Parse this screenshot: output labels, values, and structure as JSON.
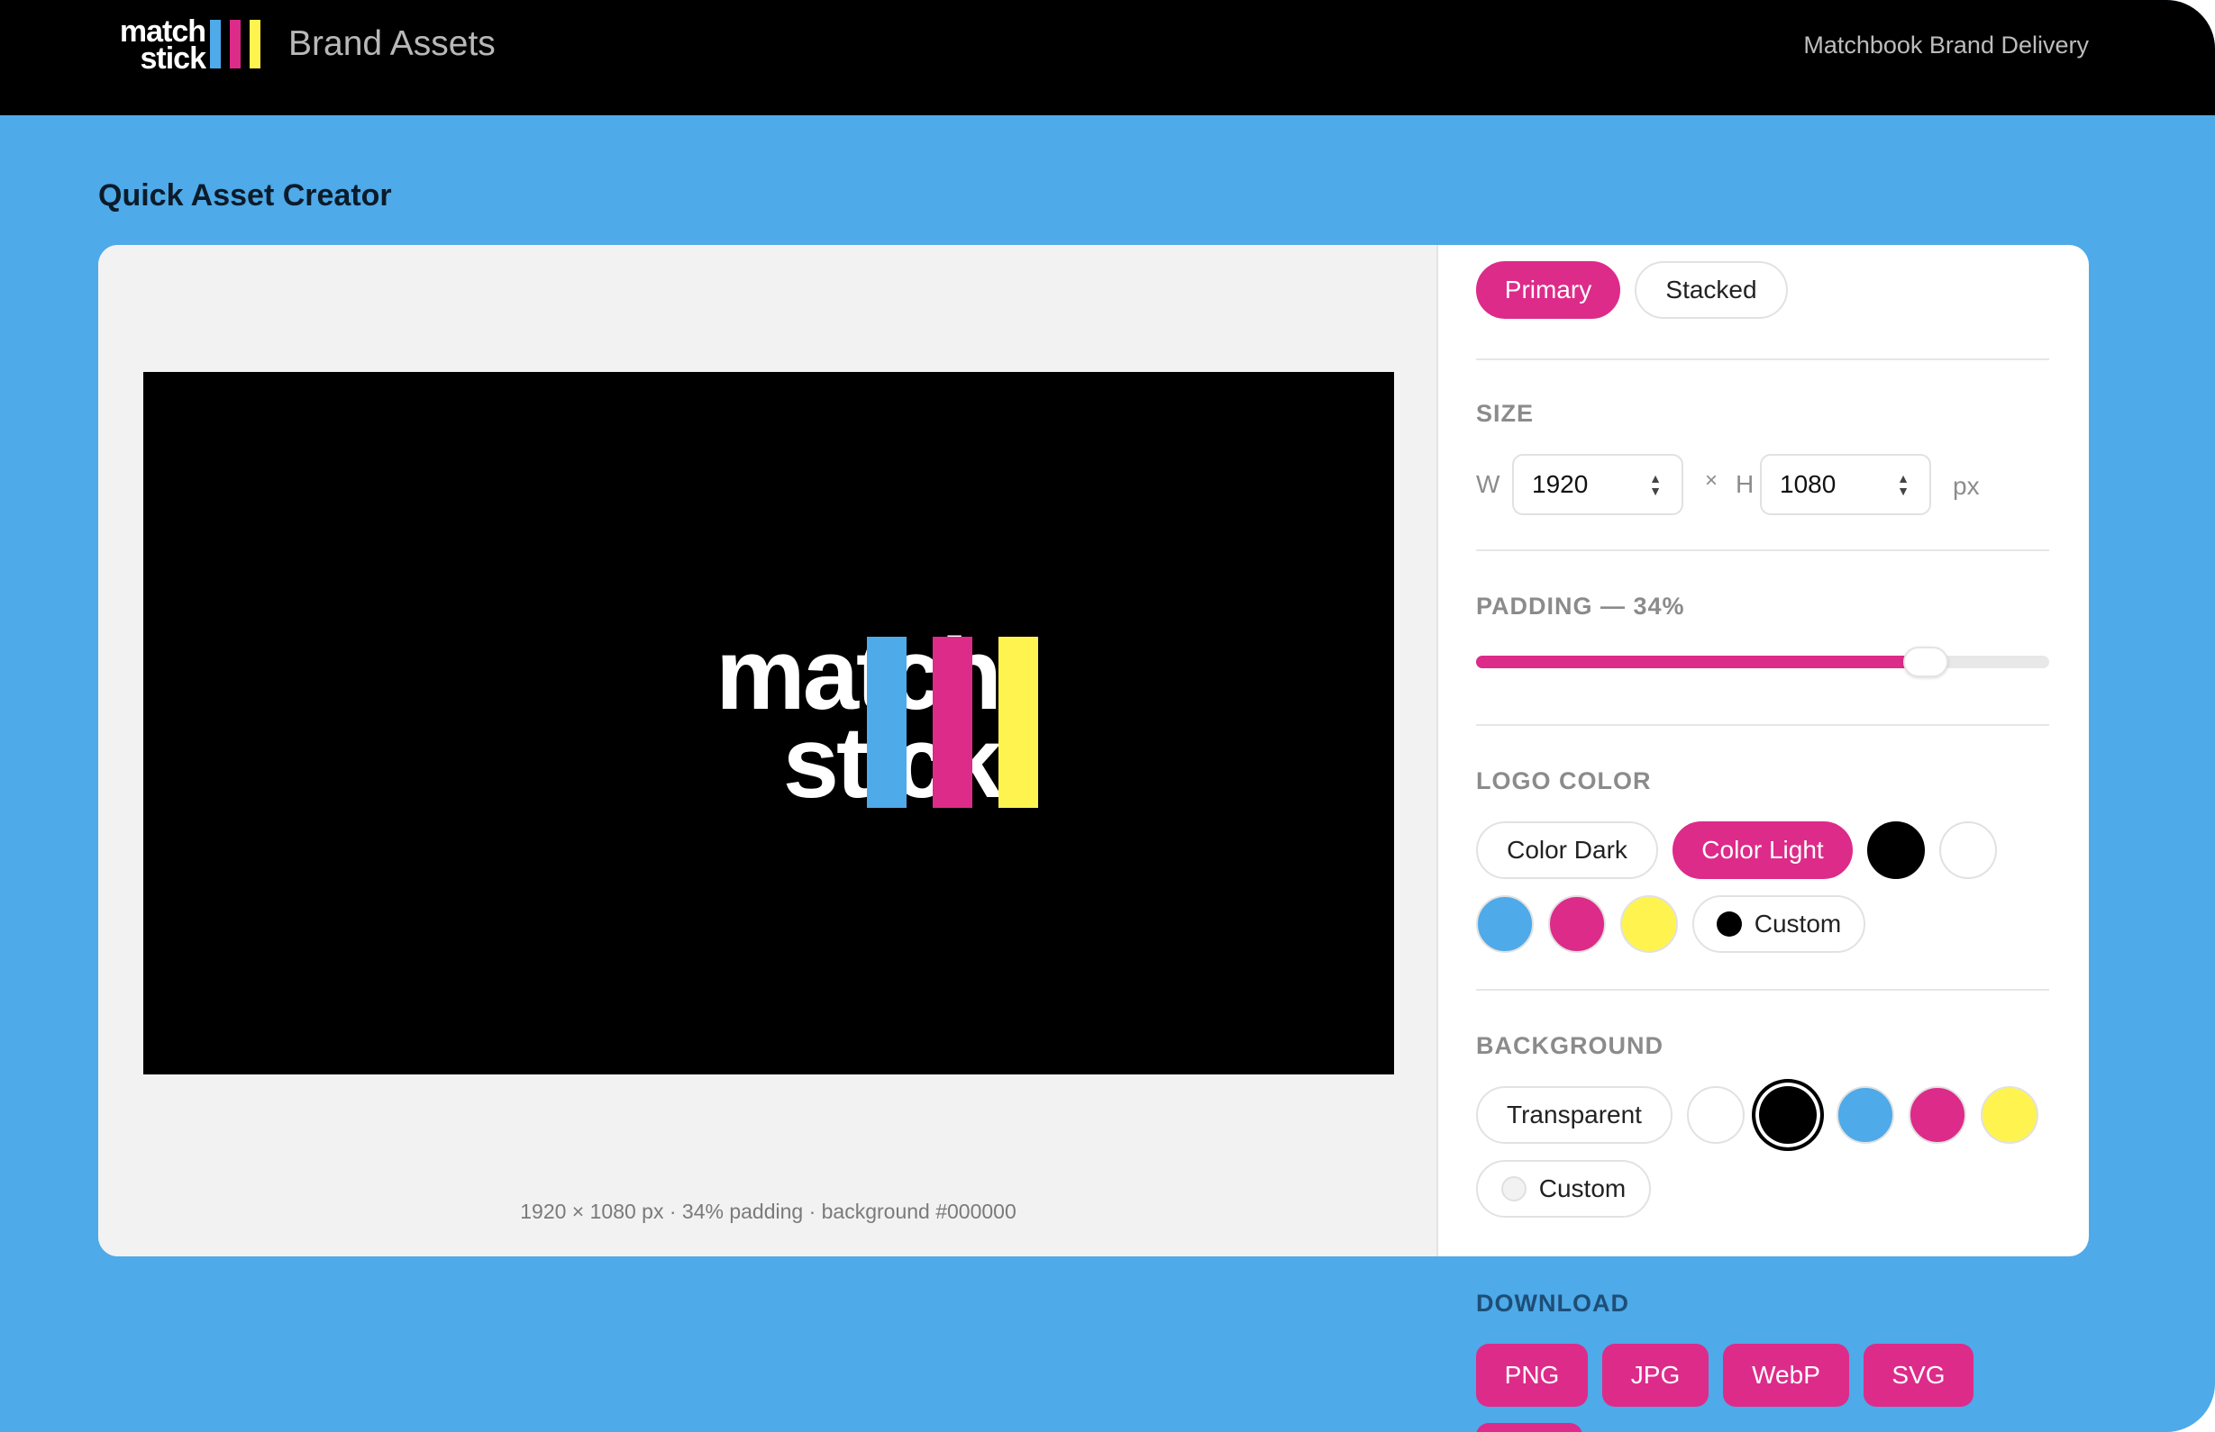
{
  "header": {
    "brand_line1": "match",
    "brand_line2": "stick",
    "title": "Brand Assets",
    "subtitle": "Matchbook Brand Delivery"
  },
  "page": {
    "heading": "Quick Asset Creator"
  },
  "preview": {
    "logo_line1": "match",
    "logo_line2": "stick",
    "caption": "1920 × 1080 px · 34% padding · background #000000"
  },
  "brand_colors": {
    "blue": "#4eaae8",
    "pink": "#dd2b8a",
    "yellow": "#fff44f",
    "black": "#000000",
    "white": "#ffffff"
  },
  "variant_tabs": [
    {
      "label": "Primary",
      "active": true
    },
    {
      "label": "Stacked",
      "active": false
    }
  ],
  "size": {
    "label": "SIZE",
    "w_label": "W",
    "width": "1920",
    "times": "×",
    "h_label": "H",
    "height": "1080",
    "unit": "px"
  },
  "padding": {
    "label": "PADDING — 34%",
    "value_percent": 34
  },
  "logo_color": {
    "label": "LOGO COLOR",
    "options": [
      "Color Dark",
      "Color Light"
    ],
    "selected": "Color Light",
    "swatches": [
      "black",
      "white",
      "blue",
      "pink",
      "yellow"
    ],
    "custom_label": "Custom"
  },
  "background": {
    "label": "BACKGROUND",
    "transparent_label": "Transparent",
    "swatches": [
      "white",
      "black",
      "blue",
      "pink",
      "yellow"
    ],
    "selected": "black",
    "custom_label": "Custom"
  },
  "download": {
    "label": "DOWNLOAD",
    "buttons": [
      "PNG",
      "JPG",
      "WebP",
      "SVG"
    ]
  }
}
